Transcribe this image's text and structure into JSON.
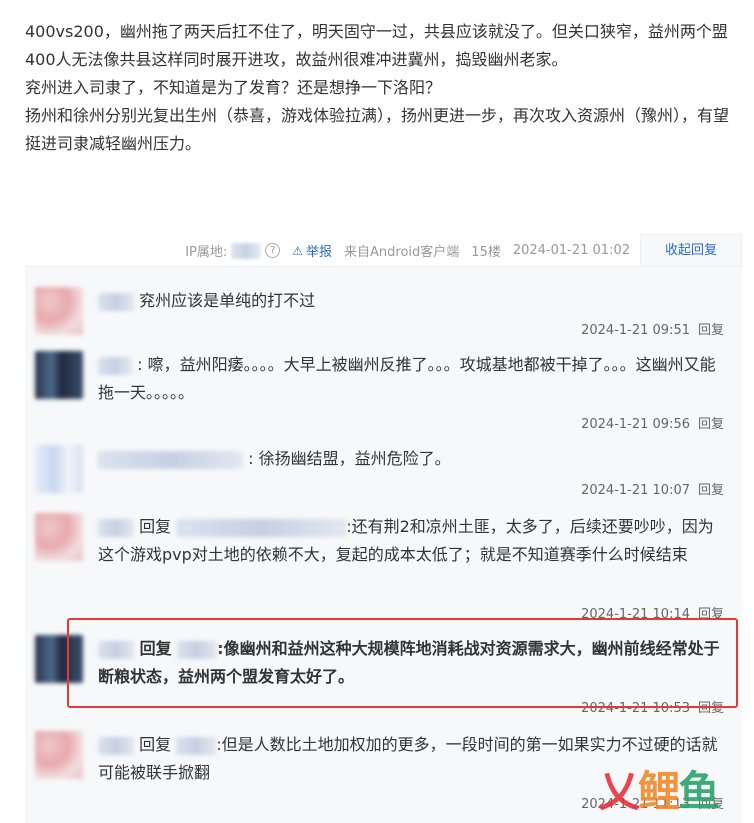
{
  "post": {
    "paragraphs": [
      "400vs200，幽州拖了两天后扛不住了，明天固守一过，共县应该就没了。但关口狭窄，益州两个盟400人无法像共县这样同时展开进攻，故益州很难冲进冀州，捣毁幽州老家。",
      "兖州进入司隶了，不知道是为了发育？还是想挣一下洛阳？",
      "扬州和徐州分别光复出生州（恭喜，游戏体验拉满），扬州更进一步，再次攻入资源州（豫州），有望挺进司隶减轻幽州压力。"
    ]
  },
  "meta": {
    "ip_label": "IP属地:",
    "help": "?",
    "report": "举报",
    "source": "来自Android客户端",
    "floor": "15楼",
    "time": "2024-01-21 01:02",
    "collapse": "收起回复"
  },
  "replies": [
    {
      "text": "兖州应该是单纯的打不过",
      "time": "2024-1-21 09:51",
      "reply": "回复"
    },
    {
      "text": ": 嚓，益州阳痿。。。。大早上被幽州反推了。。。攻城基地都被干掉了。。。这幽州又能拖一天。。。。。",
      "time": "2024-1-21 09:56",
      "reply": "回复"
    },
    {
      "text": ": 徐扬幽结盟，益州危险了。",
      "time": "2024-1-21 10:07",
      "reply": "回复"
    },
    {
      "prefix": "回复",
      "text": ":还有荆2和凉州土匪，太多了，后续还要吵吵，因为这个游戏pvp对土地的依赖不大，复起的成本太低了；就是不知道赛季什么时候结束",
      "time": "2024-1-21 10:14",
      "reply": "回复"
    },
    {
      "prefix": "回复",
      "text": ":像幽州和益州这种大规模阵地消耗战对资源需求大，幽州前线经常处于断粮状态，益州两个盟发育太好了。",
      "time": "2024-1-21 10:53",
      "reply": "回复"
    },
    {
      "prefix": "回复",
      "text": ":但是人数比土地加权加的更多，一段时间的第一如果实力不过硬的话就可能被联手掀翻",
      "time": "2024-1-21 11:13",
      "reply": "回复"
    }
  ],
  "watermark": {
    "a": "乂",
    "b": "鲤",
    "c": "鱼"
  },
  "colors": {
    "link": "#2b6bc2",
    "highlight": "#e53935",
    "panel": "#f7f8fa"
  }
}
